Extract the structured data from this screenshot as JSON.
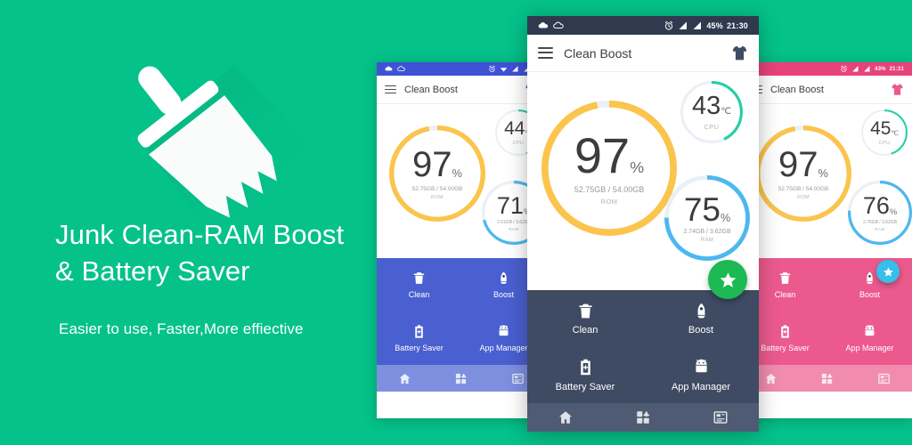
{
  "promo": {
    "background_color": "#05c28a",
    "logo_icon": "broom-icon",
    "title": "Junk Clean-RAM Boost\n& Battery Saver",
    "subtitle": "Easier to use, Faster,More effiective"
  },
  "phones": [
    {
      "id": "left",
      "theme_color": "#4a5fd0",
      "statusbar_color": "#3f51d4",
      "tabbar_color": "#7e8fe0",
      "accent_fab": null,
      "statusbar": {
        "left_icons": [
          "cloud-icon",
          "cloud-outline-icon"
        ],
        "right_icons": [
          "alarm-icon",
          "wifi-icon",
          "signal-icon",
          "signal-icon"
        ],
        "battery": "",
        "time": ""
      },
      "appbar": {
        "menu_icon": "hamburger-icon",
        "title": "Clean Boost",
        "action_icon": "tshirt-icon"
      },
      "gauges": {
        "rom": {
          "value": 97,
          "unit": "%",
          "detail": "52.75GB / 54.00GB",
          "caption": "ROM",
          "color": "#fbc44c"
        },
        "cpu": {
          "value": 44,
          "unit": "℃",
          "caption": "CPU",
          "color": "#25cfa8"
        },
        "ram": {
          "value": 71,
          "unit": "%",
          "detail": "2.61GB / 3.62GB",
          "caption": "RAM",
          "color": "#4db8ef"
        }
      },
      "actions": [
        {
          "icon": "trash-icon",
          "label": "Clean"
        },
        {
          "icon": "rocket-icon",
          "label": "Boost"
        },
        {
          "icon": "battery-plus-icon",
          "label": "Battery Saver"
        },
        {
          "icon": "android-icon",
          "label": "App Manager"
        }
      ],
      "tabs": [
        "home-icon",
        "apps-grid-icon",
        "news-icon"
      ]
    },
    {
      "id": "center",
      "theme_color": "#3f4b63",
      "statusbar_color": "#2f3a4f",
      "tabbar_color": "#4e5b73",
      "accent_fab": "#1db954",
      "statusbar": {
        "left_icons": [
          "cloud-icon",
          "cloud-outline-icon"
        ],
        "right_icons": [
          "alarm-icon",
          "signal-icon",
          "signal-icon"
        ],
        "battery": "45%",
        "time": "21:30"
      },
      "appbar": {
        "menu_icon": "hamburger-icon",
        "title": "Clean Boost",
        "action_icon": "tshirt-icon"
      },
      "gauges": {
        "rom": {
          "value": 97,
          "unit": "%",
          "detail": "52.75GB / 54.00GB",
          "caption": "ROM",
          "color": "#fbc44c"
        },
        "cpu": {
          "value": 43,
          "unit": "℃",
          "caption": "CPU",
          "color": "#25cfa8"
        },
        "ram": {
          "value": 75,
          "unit": "%",
          "detail": "2.74GB / 3.62GB",
          "caption": "RAM",
          "color": "#4db8ef"
        }
      },
      "actions": [
        {
          "icon": "trash-icon",
          "label": "Clean"
        },
        {
          "icon": "rocket-icon",
          "label": "Boost"
        },
        {
          "icon": "battery-plus-icon",
          "label": "Battery Saver"
        },
        {
          "icon": "android-icon",
          "label": "App Manager"
        }
      ],
      "tabs": [
        "home-icon",
        "apps-grid-icon",
        "news-icon"
      ],
      "fab_icon": "star-icon"
    },
    {
      "id": "right",
      "theme_color": "#ec5a8d",
      "statusbar_color": "#e8427c",
      "tabbar_color": "#f18cae",
      "accent_fab": "#33c0ea",
      "statusbar": {
        "left_icons": [],
        "right_icons": [
          "alarm-icon",
          "signal-icon",
          "signal-icon"
        ],
        "battery": "43%",
        "time": "21:31"
      },
      "appbar": {
        "menu_icon": "hamburger-icon",
        "title": "Clean Boost",
        "action_icon": "tshirt-icon"
      },
      "gauges": {
        "rom": {
          "value": 97,
          "unit": "%",
          "detail": "52.75GB / 54.00GB",
          "caption": "ROM",
          "color": "#fbc44c"
        },
        "cpu": {
          "value": 45,
          "unit": "℃",
          "caption": "CPU",
          "color": "#25cfa8"
        },
        "ram": {
          "value": 76,
          "unit": "%",
          "detail": "2.76GB / 3.62GB",
          "caption": "RAM",
          "color": "#4db8ef"
        }
      },
      "actions": [
        {
          "icon": "trash-icon",
          "label": "Clean"
        },
        {
          "icon": "rocket-icon",
          "label": "Boost"
        },
        {
          "icon": "battery-plus-icon",
          "label": "Battery Saver"
        },
        {
          "icon": "android-icon",
          "label": "App Manager"
        }
      ],
      "tabs": [
        "home-icon",
        "apps-grid-icon",
        "news-icon"
      ],
      "fab_icon": "star-icon"
    }
  ]
}
